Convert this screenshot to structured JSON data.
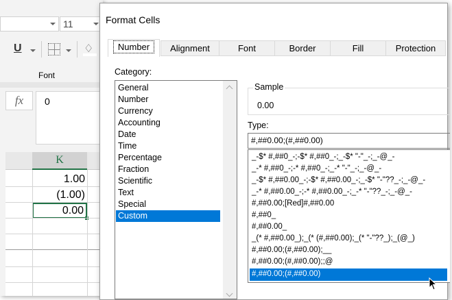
{
  "excel": {
    "font_size": "11",
    "underline_label": "U",
    "font_group_label": "Font",
    "fx_label": "fx",
    "formula_value": "0",
    "column_header": "K",
    "cells": [
      "1.00",
      "(1.00)",
      "0.00"
    ]
  },
  "dialog": {
    "title": "Format Cells",
    "tabs": [
      "Number",
      "Alignment",
      "Font",
      "Border",
      "Fill",
      "Protection"
    ],
    "category_label": "Category:",
    "categories": [
      "General",
      "Number",
      "Currency",
      "Accounting",
      "Date",
      "Time",
      "Percentage",
      "Fraction",
      "Scientific",
      "Text",
      "Special",
      "Custom"
    ],
    "selected_category": "Custom",
    "sample_label": "Sample",
    "sample_value": "0.00",
    "type_label": "Type:",
    "type_value": "#,##0.00;(#,##0.00)",
    "type_list": [
      "_-$* #,##0_-;-$* #,##0_-;_-$* \"-\"_-;_-@_-",
      "_-* #,##0_-;-* #,##0_-;_-* \"-\"_-;_-@_-",
      "_-$* #,##0.00_-;-$* #,##0.00_-;_-$* \"-\"??_-;_-@_-",
      "_-* #,##0.00_-;-* #,##0.00_-;_-* \"-\"??_-;_-@_-",
      "#,##0.00;[Red]#,##0.00",
      "#,##0_",
      "#,##0.00_",
      "_(* #,##0.00_);_(* (#,##0.00);_(* \"-\"??_);_(@_)",
      "#,##0.00;(#,##0.00);__",
      "#,##0.00;(#,##0.00);;@",
      "#,##0.00;(#,##0.00)"
    ],
    "selected_type": "#,##0.00;(#,##0.00)"
  }
}
